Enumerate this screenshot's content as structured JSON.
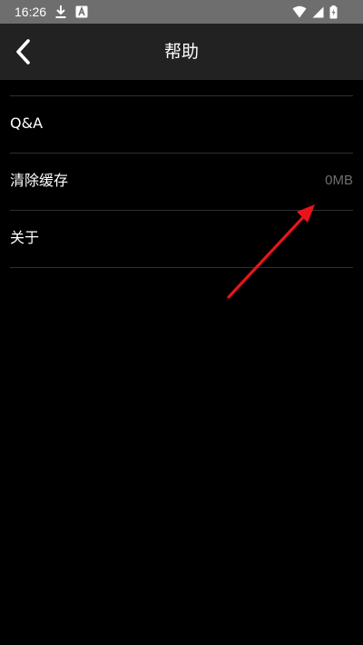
{
  "status_bar": {
    "time": "16:26",
    "left_icons": [
      "download-icon",
      "app-notification-icon"
    ],
    "right_icons": [
      "wifi-icon",
      "cellular-signal-icon",
      "battery-charging-icon"
    ]
  },
  "app_bar": {
    "back_icon": "chevron-left-icon",
    "title": "帮助"
  },
  "settings": {
    "items": [
      {
        "label": "Q&A",
        "value": ""
      },
      {
        "label": "清除缓存",
        "value": "0MB"
      },
      {
        "label": "关于",
        "value": ""
      }
    ]
  },
  "annotation": {
    "arrow_color": "#e8141c"
  },
  "colors": {
    "status_bar_bg": "#6e6e6e",
    "app_bar_bg": "#222222",
    "page_bg": "#000000",
    "divider": "#2f2f2f",
    "value_text": "#6f6f6f"
  }
}
